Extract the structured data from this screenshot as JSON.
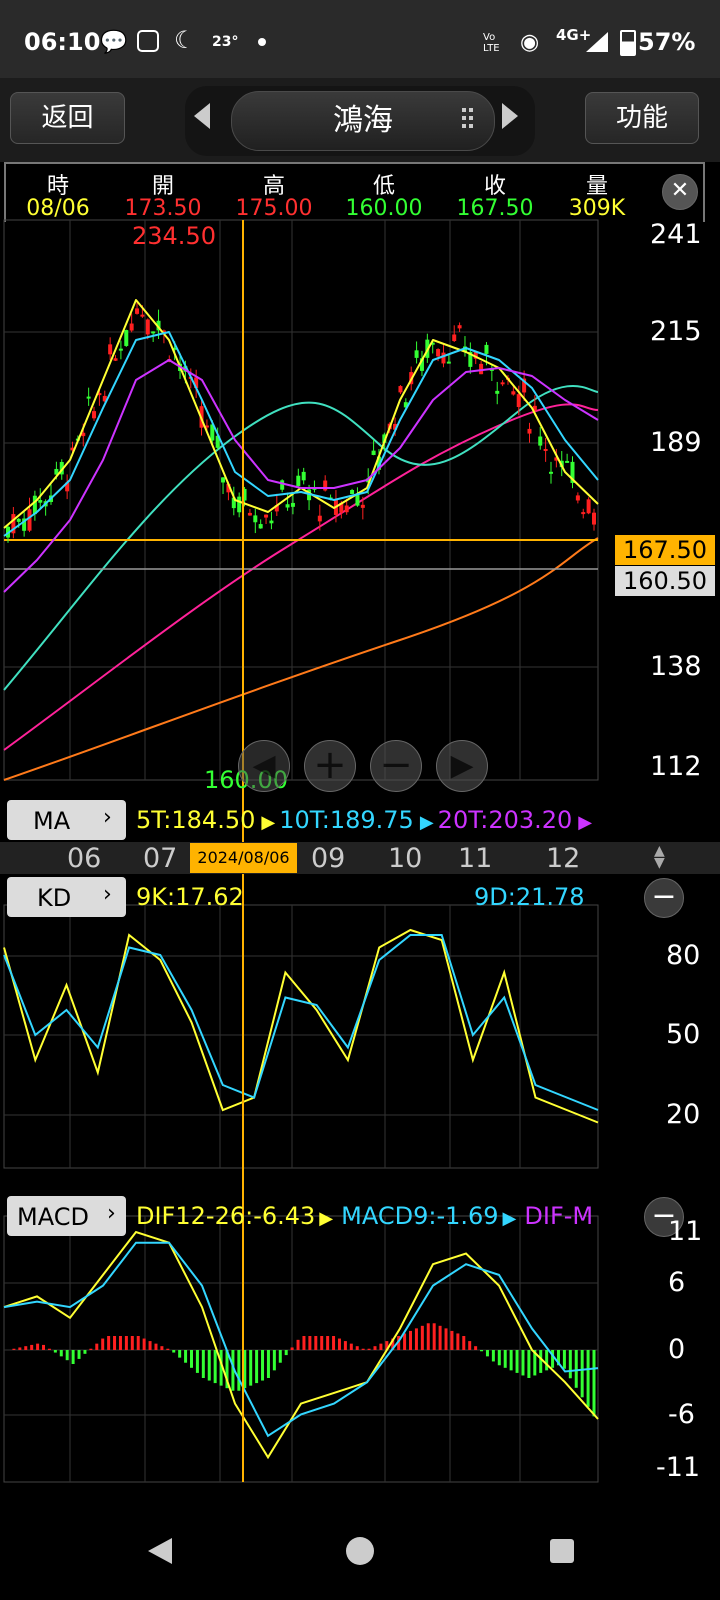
{
  "status_bar": {
    "time": "06:10",
    "temp": "23°",
    "network": "4G+",
    "battery": "57%",
    "volte": "Vo LTE"
  },
  "header": {
    "back_label": "返回",
    "stock_name": "鴻海",
    "func_label": "功能"
  },
  "ohlc": {
    "labels": [
      "時",
      "開",
      "高",
      "低",
      "收",
      "量"
    ],
    "values": [
      "08/06",
      "173.50",
      "175.00",
      "160.00",
      "167.50",
      "309K"
    ],
    "colors": [
      "#ffff33",
      "#ff3030",
      "#ff3030",
      "#33ff33",
      "#33ff33",
      "#ffff33"
    ]
  },
  "price_chart": {
    "y_labels": [
      "241",
      "215",
      "189",
      "138",
      "112"
    ],
    "high_annotation": "234.50",
    "low_annotation": "160.00",
    "close_tag": "167.50",
    "low_tag": "160.50"
  },
  "ma_panel": {
    "button": "MA",
    "legend": [
      {
        "text": "5T:184.50",
        "color": "#ffff33"
      },
      {
        "text": "10T:189.75",
        "color": "#33d6ff"
      },
      {
        "text": "20T:203.20",
        "color": "#cc33ff"
      }
    ]
  },
  "x_axis": {
    "labels": [
      "06",
      "07",
      "09",
      "10",
      "11",
      "12"
    ],
    "cursor_date": "2024/08/06"
  },
  "kd_panel": {
    "button": "KD",
    "k_label": "9K:17.62",
    "d_label": "9D:21.78",
    "y_labels": [
      "80",
      "50",
      "20"
    ]
  },
  "macd_panel": {
    "button": "MACD",
    "legend": [
      {
        "text": "DIF12-26:-6.43",
        "color": "#ffff33"
      },
      {
        "text": "MACD9:-1.69",
        "color": "#33d6ff"
      },
      {
        "text": "DIF-M",
        "color": "#cc33ff"
      }
    ],
    "y_labels": [
      "11",
      "6",
      "0",
      "-6",
      "-11"
    ]
  },
  "colors": {
    "up": "#ff2020",
    "down": "#33ff33",
    "cursor": "#ffb300",
    "ma5": "#ffff33",
    "ma10": "#33d6ff",
    "ma20": "#cc33ff",
    "ma60": "#40e0c0",
    "ma120": "#ff2299",
    "ma240": "#ff7a1a"
  },
  "chart_data": [
    {
      "type": "line",
      "title": "",
      "xlabel": "",
      "ylabel": "",
      "x_ticks": [
        "06",
        "07",
        "08",
        "09",
        "10",
        "11",
        "12"
      ],
      "ylim": [
        105,
        245
      ],
      "y_ticks": [
        241,
        215,
        189,
        138,
        112
      ],
      "series": [
        {
          "name": "5T",
          "values": [
            168,
            175,
            185,
            205,
            225,
            215,
            195,
            175,
            172,
            178,
            173,
            178,
            200,
            215,
            212,
            208,
            198,
            182,
            174
          ]
        },
        {
          "name": "10T",
          "values": [
            166,
            172,
            180,
            198,
            215,
            217,
            200,
            182,
            176,
            177,
            175,
            177,
            195,
            210,
            213,
            210,
            203,
            190,
            180
          ]
        },
        {
          "name": "20T",
          "values": [
            152,
            160,
            170,
            185,
            205,
            210,
            205,
            190,
            180,
            178,
            178,
            180,
            188,
            200,
            207,
            208,
            206,
            200,
            195
          ]
        }
      ]
    },
    {
      "type": "line",
      "title": "",
      "ylim": [
        0,
        100
      ],
      "y_ticks": [
        80,
        50,
        20
      ],
      "series": [
        {
          "name": "9K",
          "values": [
            85,
            40,
            70,
            35,
            90,
            80,
            55,
            20,
            25,
            75,
            60,
            40,
            85,
            92,
            88,
            40,
            75,
            25,
            20,
            15
          ]
        },
        {
          "name": "9D",
          "values": [
            82,
            50,
            60,
            45,
            85,
            82,
            60,
            30,
            25,
            65,
            62,
            45,
            80,
            90,
            90,
            50,
            65,
            30,
            25,
            20
          ]
        }
      ]
    },
    {
      "type": "line",
      "title": "",
      "ylim": [
        -11,
        11
      ],
      "y_ticks": [
        11,
        6,
        0,
        -6,
        -11
      ],
      "series": [
        {
          "name": "DIF12-26",
          "values": [
            4,
            5,
            3,
            7,
            11,
            10,
            4,
            -5,
            -10,
            -5,
            -4,
            -3,
            2,
            8,
            9,
            6,
            0,
            -3,
            -6.43
          ]
        },
        {
          "name": "MACD9",
          "values": [
            4,
            4.5,
            4,
            6,
            10,
            10,
            6,
            -2,
            -8,
            -6,
            -5,
            -3,
            1,
            6,
            8,
            7,
            2,
            -2,
            -1.69
          ]
        }
      ]
    }
  ]
}
